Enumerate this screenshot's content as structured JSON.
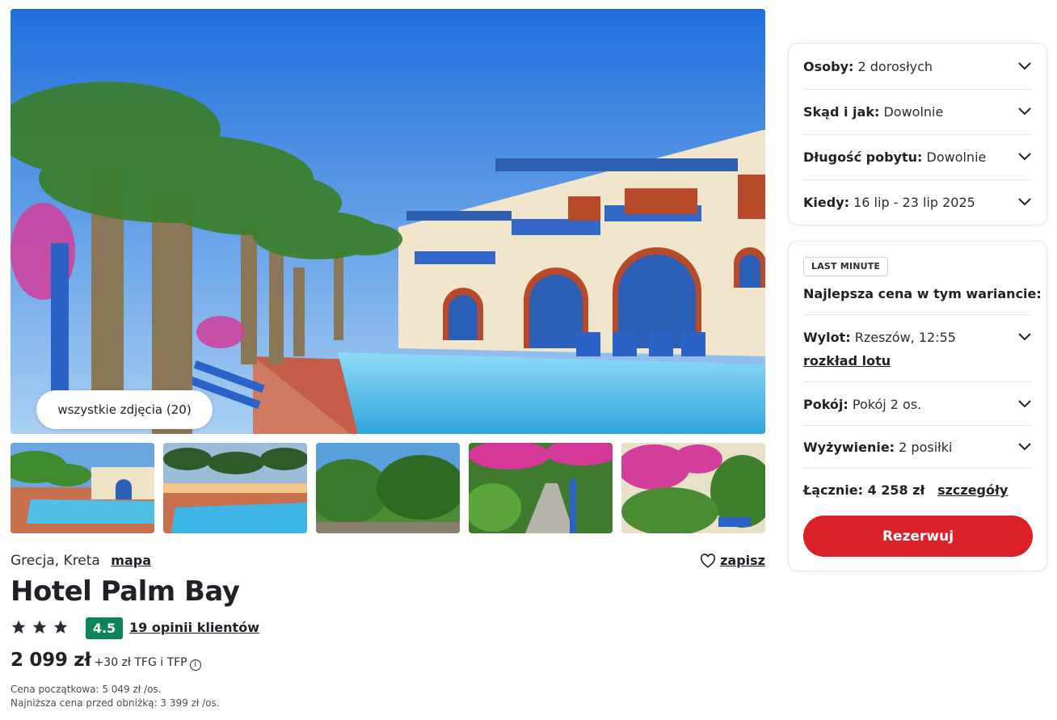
{
  "gallery": {
    "all_photos_label": "wszystkie zdjęcia (20)"
  },
  "hotel": {
    "location": "Grecja, Kreta",
    "map_link": "mapa",
    "save_label": "zapisz",
    "name": "Hotel Palm Bay",
    "stars": 3,
    "rating": "4.5",
    "reviews_link": "19 opinii klientów",
    "price": "2 099 zł",
    "price_extra": "+30 zł TFG i TFP",
    "price_start": "Cena początkowa: 5 049 zł /os.",
    "price_lowest": "Najniższa cena przed obniżką: 3 399 zł /os."
  },
  "filters": [
    {
      "label": "Osoby:",
      "value": "2 dorosłych"
    },
    {
      "label": "Skąd i jak:",
      "value": "Dowolnie"
    },
    {
      "label": "Długość pobytu:",
      "value": "Dowolnie"
    },
    {
      "label": "Kiedy:",
      "value": "16 lip - 23 lip 2025"
    }
  ],
  "offer": {
    "badge": "LAST MINUTE",
    "heading": "Najlepsza cena w tym wariancie:",
    "flight_label": "Wylot:",
    "flight_value": "Rzeszów, 12:55",
    "flight_link": "rozkład lotu",
    "room_label": "Pokój:",
    "room_value": "Pokój 2 os.",
    "board_label": "Wyżywienie:",
    "board_value": "2 posiłki",
    "total_label": "Łącznie: 4 258 zł",
    "details_link": "szczegóły",
    "reserve_label": "Rezerwuj"
  },
  "colors": {
    "accent": "#da2127",
    "rating": "#0d8457"
  }
}
